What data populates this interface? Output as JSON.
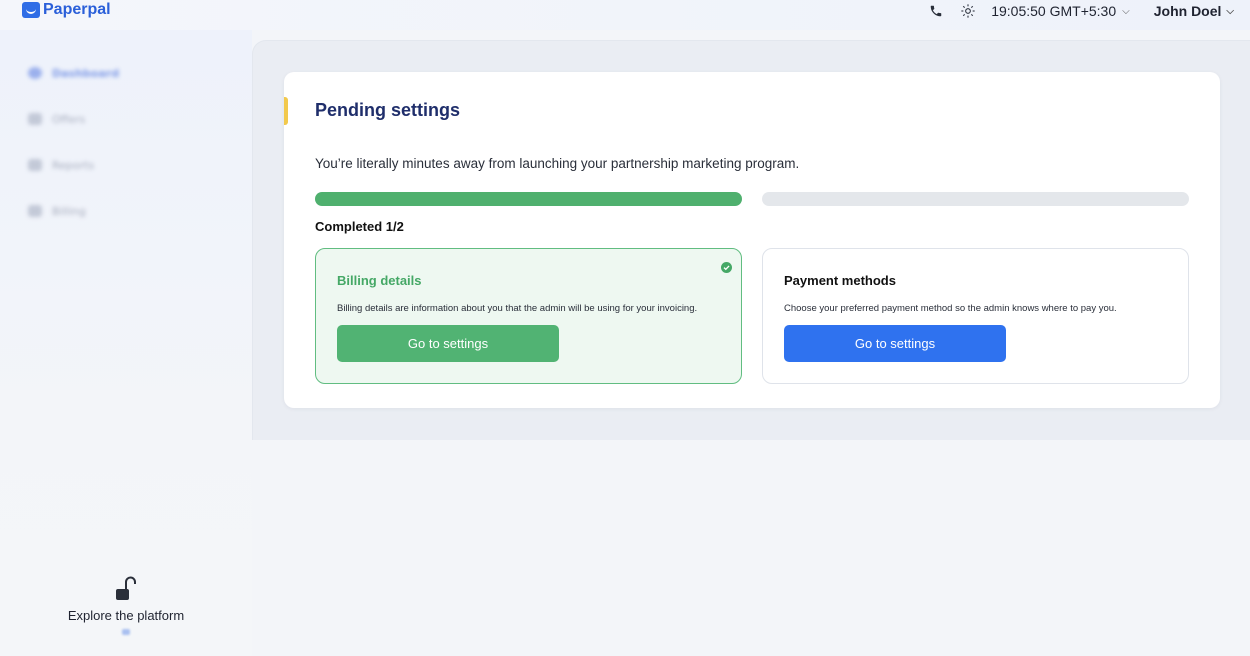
{
  "app": {
    "brand": "Paperpal"
  },
  "topbar": {
    "phone_icon": "phone-icon",
    "theme_icon": "sun-icon",
    "time": "19:05:50 GMT+5:30",
    "user_name": "John Doel"
  },
  "sidebar": {
    "items": [
      {
        "label": "Dashboard",
        "icon": "dashboard-icon",
        "active": true
      },
      {
        "label": "Offers",
        "icon": "offers-icon",
        "active": false
      },
      {
        "label": "Reports",
        "icon": "reports-icon",
        "active": false
      },
      {
        "label": "Billing",
        "icon": "billing-icon",
        "active": false
      }
    ],
    "explore_label": "Explore the platform"
  },
  "pending": {
    "title": "Pending settings",
    "description": "You’re literally minutes away from launching your partnership marketing program.",
    "progress": {
      "completed_steps": 1,
      "total_steps": 2
    },
    "completed_label": "Completed 1/2",
    "tasks": [
      {
        "title": "Billing details",
        "description": "Billing details are information about you that the admin will be using for your invoicing.",
        "button_label": "Go to settings",
        "status": "completed",
        "color": "#51b373"
      },
      {
        "title": "Payment methods",
        "description": "Choose your preferred payment method so the admin knows where to pay you.",
        "button_label": "Go to settings",
        "status": "pending",
        "color": "#2f72ef"
      }
    ]
  },
  "colors": {
    "accent_yellow": "#f2c94c",
    "success_green": "#4fb06e",
    "primary_blue": "#2f72ef",
    "title_navy": "#1f2e6b"
  }
}
